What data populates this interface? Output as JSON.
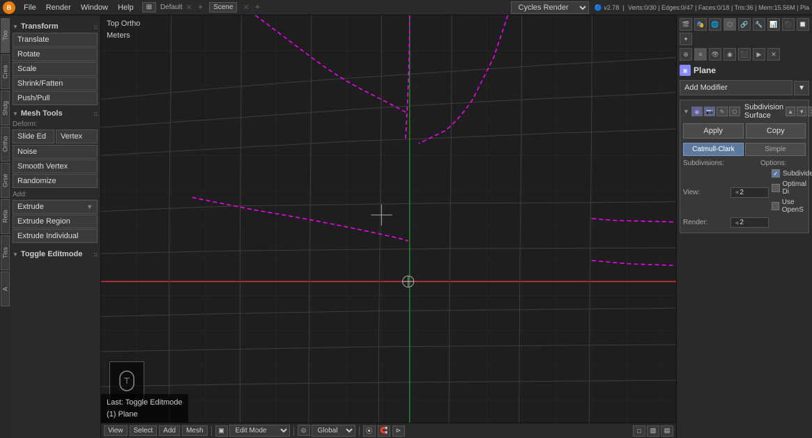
{
  "topbar": {
    "logo": "B",
    "menus": [
      "File",
      "Render",
      "Window",
      "Help"
    ],
    "editor_type": "⊞",
    "layout": "Default",
    "scene": "Scene",
    "render_engine": "Cycles Render",
    "blender_version": "v2.78",
    "stats": "Verts:0/30 | Edges:0/47 | Faces:0/18 | Tris:36 | Mem:15.56M | Pla"
  },
  "left_sidebar": {
    "tabs": [
      "Too",
      "Crea",
      "Shading/",
      "Ortho",
      "Greese Pe",
      "Relatio",
      "Tiss",
      "A"
    ],
    "transform_section": "Transform",
    "transform_tools": [
      "Translate",
      "Rotate",
      "Scale",
      "Shrink/Fatten",
      "Push/Pull"
    ],
    "mesh_tools_section": "Mesh Tools",
    "deform_label": "Deform:",
    "deform_tools": [
      {
        "type": "pair",
        "left": "Slide Ed",
        "right": "Vertex"
      },
      {
        "type": "single",
        "label": "Noise"
      },
      {
        "type": "single",
        "label": "Smooth Vertex"
      },
      {
        "type": "single",
        "label": "Randomize"
      }
    ],
    "add_label": "Add:",
    "extrude_dropdown": "Extrude",
    "add_tools": [
      "Extrude Region",
      "Extrude Individual"
    ],
    "toggle_editmode": "Toggle Editmode"
  },
  "viewport": {
    "view_name": "Top Ortho",
    "units": "Meters",
    "last_op_line1": "Last: Toggle Editmode",
    "last_op_line2": "(1) Plane"
  },
  "viewport_bottom": {
    "view_btn": "View",
    "select_btn": "Select",
    "add_btn": "Add",
    "mesh_btn": "Mesh",
    "mode": "Edit Mode",
    "global": "Global",
    "pivot": "⊙"
  },
  "right_sidebar": {
    "object_icon": "▣",
    "object_name": "Plane",
    "add_modifier_label": "Add Modifier",
    "apply_label": "Apply",
    "copy_label": "Copy",
    "modifier_name": "Subdivision Surface",
    "tabs": [
      "Catmull-Clark",
      "Simple"
    ],
    "subdivisions_label": "Subdivisions:",
    "options_label": "Options:",
    "view_label": "View:",
    "view_value": "2",
    "render_label": "Render:",
    "render_value": "2",
    "subdivide_label": "Subdivide",
    "optimal_di_label": "Optimal Di",
    "use_opens_label": "Use OpenS"
  }
}
